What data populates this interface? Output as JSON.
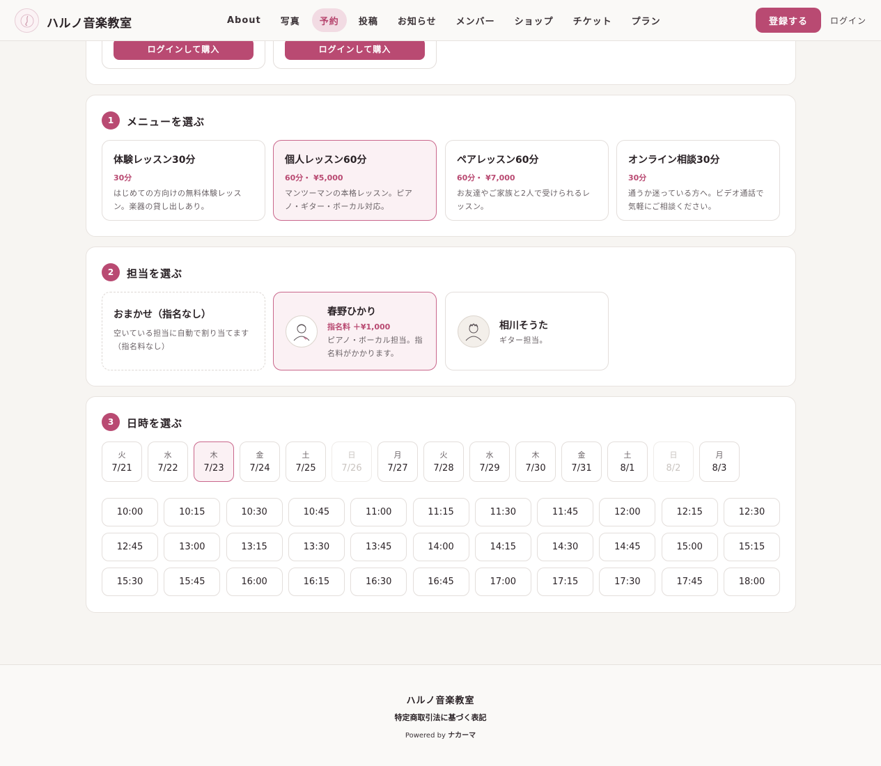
{
  "header": {
    "site_name": "ハルノ音楽教室",
    "nav": [
      "About",
      "写真",
      "予約",
      "投稿",
      "お知らせ",
      "メンバー",
      "ショップ",
      "チケット",
      "プラン"
    ],
    "active_nav": "予約",
    "register_label": "登録する",
    "login_label": "ログイン"
  },
  "top_plans": {
    "buy_label": "ログインして購入"
  },
  "menu_section": {
    "number": "1",
    "title": "メニューを選ぶ",
    "items": [
      {
        "title": "体験レッスン30分",
        "price": "30分",
        "desc": "はじめての方向けの無料体験レッスン。楽器の貸し出しあり。"
      },
      {
        "title": "個人レッスン60分",
        "price": "60分・ ¥5,000",
        "desc": "マンツーマンの本格レッスン。ピアノ・ギター・ボーカル対応。"
      },
      {
        "title": "ペアレッスン60分",
        "price": "60分・ ¥7,000",
        "desc": "お友達やご家族と2人で受けられるレッスン。"
      },
      {
        "title": "オンライン相談30分",
        "price": "30分",
        "desc": "通うか迷っている方へ。ビデオ通話で気軽にご相談ください。"
      }
    ],
    "selected_index": 1
  },
  "staff_section": {
    "number": "2",
    "title": "担当を選ぶ",
    "any": {
      "name": "おまかせ（指名なし）",
      "desc": "空いている担当に自動で割り当てます（指名料なし）"
    },
    "staff": [
      {
        "name": "春野ひかり",
        "fee": "指名料 ＋¥1,000",
        "desc": "ピアノ・ボーカル担当。指名料がかかります。"
      },
      {
        "name": "相川そうた",
        "desc": "ギター担当。"
      }
    ]
  },
  "date_section": {
    "number": "3",
    "title": "日時を選ぶ",
    "dates": [
      {
        "dow": "火",
        "date": "7/21"
      },
      {
        "dow": "水",
        "date": "7/22"
      },
      {
        "dow": "木",
        "date": "7/23"
      },
      {
        "dow": "金",
        "date": "7/24"
      },
      {
        "dow": "土",
        "date": "7/25"
      },
      {
        "dow": "日",
        "date": "7/26"
      },
      {
        "dow": "月",
        "date": "7/27"
      },
      {
        "dow": "火",
        "date": "7/28"
      },
      {
        "dow": "水",
        "date": "7/29"
      },
      {
        "dow": "木",
        "date": "7/30"
      },
      {
        "dow": "金",
        "date": "7/31"
      },
      {
        "dow": "土",
        "date": "8/1"
      },
      {
        "dow": "日",
        "date": "8/2"
      },
      {
        "dow": "月",
        "date": "8/3"
      }
    ],
    "selected_date": "7/23",
    "disabled_dates": [
      "7/26",
      "8/2"
    ],
    "times": [
      "10:00",
      "10:15",
      "10:30",
      "10:45",
      "11:00",
      "11:15",
      "11:30",
      "11:45",
      "12:00",
      "12:15",
      "12:30",
      "12:45",
      "13:00",
      "13:15",
      "13:30",
      "13:45",
      "14:00",
      "14:15",
      "14:30",
      "14:45",
      "15:00",
      "15:15",
      "15:30",
      "15:45",
      "16:00",
      "16:15",
      "16:30",
      "16:45",
      "17:00",
      "17:15",
      "17:30",
      "17:45",
      "18:00"
    ]
  },
  "footer": {
    "site_name": "ハルノ音楽教室",
    "law_link": "特定商取引法に基づく表記",
    "powered_prefix": "Powered by",
    "powered_brand": "ナカーマ"
  },
  "colors": {
    "accent": "#b94a72",
    "accent_light": "#fbf1f4",
    "background": "#f7f5f2"
  }
}
